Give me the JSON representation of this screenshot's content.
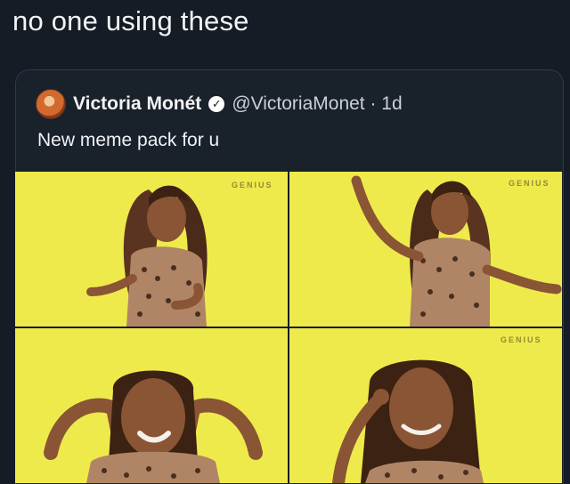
{
  "caption": "no one using these",
  "tweet": {
    "display_name": "Victoria Monét",
    "handle_time": "@VictoriaMonet · 1d",
    "text": "New meme pack for u"
  },
  "icons": {
    "avatar": "avatar-photo",
    "verified": "verified-check-icon"
  },
  "colors": {
    "background": "#151c25",
    "tile_background": "#efea4b"
  },
  "grid": {
    "images": [
      {
        "name": "meme-image-1",
        "watermark": "GENIUS"
      },
      {
        "name": "meme-image-2",
        "watermark": "GENIUS"
      },
      {
        "name": "meme-image-3",
        "watermark": ""
      },
      {
        "name": "meme-image-4",
        "watermark": "GENIUS"
      }
    ]
  }
}
